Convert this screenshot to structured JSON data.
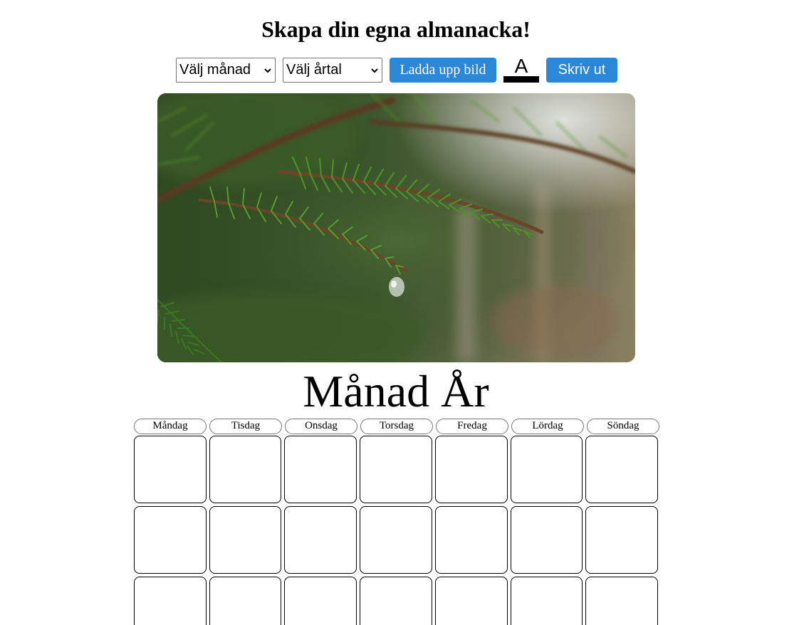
{
  "header": {
    "title": "Skapa din egna almanacka!"
  },
  "controls": {
    "month_select": "Välj månad",
    "year_select": "Välj årtal",
    "upload_label": "Ladda upp bild",
    "text_color_letter": "A",
    "text_color": "#000000",
    "print_label": "Skriv ut",
    "button_color": "#2b87d8"
  },
  "calendar": {
    "heading": "Månad År",
    "weekdays": [
      "Måndag",
      "Tisdag",
      "Onsdag",
      "Torsdag",
      "Fredag",
      "Lördag",
      "Söndag"
    ]
  }
}
